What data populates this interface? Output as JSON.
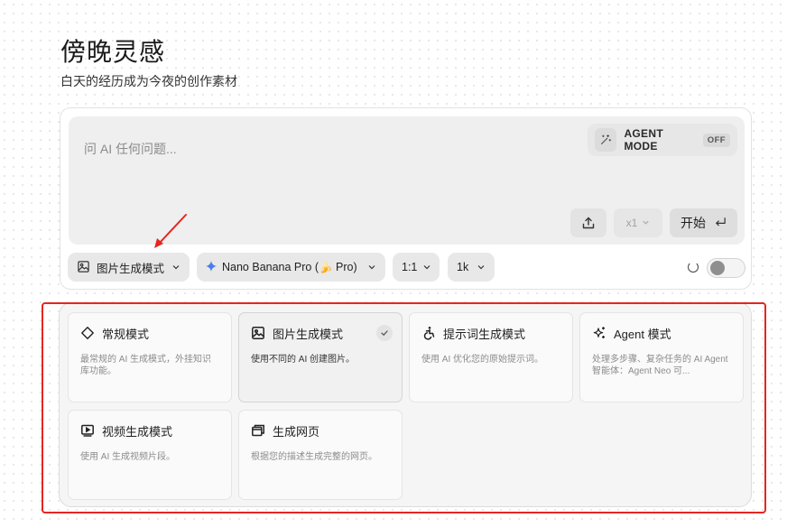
{
  "header": {
    "title": "傍晚灵感",
    "subtitle": "白天的经历成为今夜的创作素材"
  },
  "composer": {
    "placeholder": "问 AI 任何问题...",
    "agent_mode": {
      "label": "AGENT MODE",
      "state": "OFF"
    },
    "count": "x1",
    "start_label": "开始",
    "pills": {
      "mode": "图片生成模式",
      "model": "Nano Banana Pro (🍌 Pro)",
      "ratio": "1:1",
      "resolution": "1k"
    }
  },
  "modes": [
    {
      "title": "常规模式",
      "desc": "最常规的 AI 生成模式，外挂知识库功能。",
      "icon": "diamond-icon",
      "active": false
    },
    {
      "title": "图片生成模式",
      "desc": "使用不同的 AI 创建图片。",
      "icon": "image-icon",
      "active": true
    },
    {
      "title": "提示词生成模式",
      "desc": "使用 AI 优化您的原始提示词。",
      "icon": "accessibility-icon",
      "active": false
    },
    {
      "title": "Agent 模式",
      "desc": "处理多步骤、复杂任务的 AI Agent 智能体：Agent Neo 可...",
      "icon": "sparkles-icon",
      "active": false
    },
    {
      "title": "视频生成模式",
      "desc": "使用 AI 生成视频片段。",
      "icon": "video-icon",
      "active": false
    },
    {
      "title": "生成网页",
      "desc": "根据您的描述生成完整的网页。",
      "icon": "window-icon",
      "active": false
    }
  ],
  "colors": {
    "annotation_red": "#e5261f",
    "accent_blue": "#4a7cf0"
  }
}
